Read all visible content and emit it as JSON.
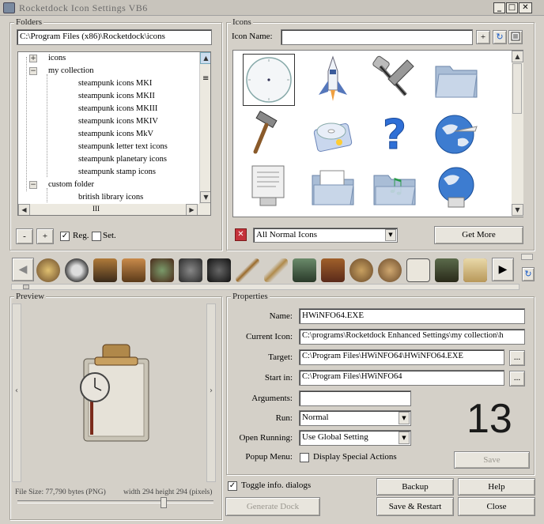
{
  "window": {
    "title": "Rocketdock Icon Settings VB6",
    "minimize": "_",
    "maximize": "□",
    "close": "✕"
  },
  "folders": {
    "label": "Folders",
    "path": "C:\\Program Files (x86)\\Rocketdock\\icons",
    "tree": [
      {
        "label": "icons",
        "expander": "+"
      },
      {
        "label": "my collection",
        "expander": "−"
      },
      {
        "label": "steampunk icons MKI"
      },
      {
        "label": "steampunk icons MKII"
      },
      {
        "label": "steampunk icons MKIII"
      },
      {
        "label": "steampunk icons MKIV"
      },
      {
        "label": "steampunk icons MkV"
      },
      {
        "label": "steampunk letter text icons"
      },
      {
        "label": "steampunk planetary icons"
      },
      {
        "label": "steampunk stamp icons"
      },
      {
        "label": "custom folder",
        "expander": "−"
      },
      {
        "label": "british library icons"
      }
    ],
    "minus": "-",
    "plus": "+",
    "reg_label": "Reg.",
    "reg_checked": "✓",
    "set_label": "Set."
  },
  "icons": {
    "label": "Icons",
    "name_label": "Icon Name:",
    "name_value": "",
    "plus": "+",
    "refresh": "↻",
    "filter_value": "All Normal Icons",
    "get_more": "Get More",
    "grid": [
      "clock-icon",
      "space-shuttle-icon",
      "tools-icon",
      "folder-icon",
      "hammer-icon",
      "disc-icon",
      "help-icon",
      "globe-icon",
      "document-icon",
      "documents-folder-icon",
      "music-folder-icon",
      "network-globe-icon"
    ]
  },
  "preview": {
    "label": "Preview",
    "file_info": "File Size: 77,790 bytes (PNG)",
    "dims": "width 294 height 294 (pixels)",
    "prev": "‹",
    "next": "›"
  },
  "properties": {
    "label": "Properties",
    "name_label": "Name:",
    "name_value": "HWiNFO64.EXE",
    "current_icon_label": "Current Icon:",
    "current_icon_value": "C:\\programs\\Rocketdock Enhanced Settings\\my collection\\h",
    "target_label": "Target:",
    "target_value": "C:\\Program Files\\HWiNFO64\\HWiNFO64.EXE",
    "start_label": "Start in:",
    "start_value": "C:\\Program Files\\HWiNFO64",
    "args_label": "Arguments:",
    "args_value": "",
    "run_label": "Run:",
    "run_value": "Normal",
    "open_running_label": "Open Running:",
    "open_running_value": "Use Global Setting",
    "popup_label": "Popup Menu:",
    "popup_text": "Display Special Actions",
    "browse": "...",
    "big_number": "13",
    "save": "Save"
  },
  "bottom": {
    "toggle_label": "Toggle info. dialogs",
    "toggle_checked": "✓",
    "generate": "Generate Dock",
    "backup": "Backup",
    "help": "Help",
    "save_restart": "Save & Restart",
    "close": "Close"
  },
  "strip": {
    "left": "◀",
    "right": "▶",
    "refresh": "↻"
  }
}
